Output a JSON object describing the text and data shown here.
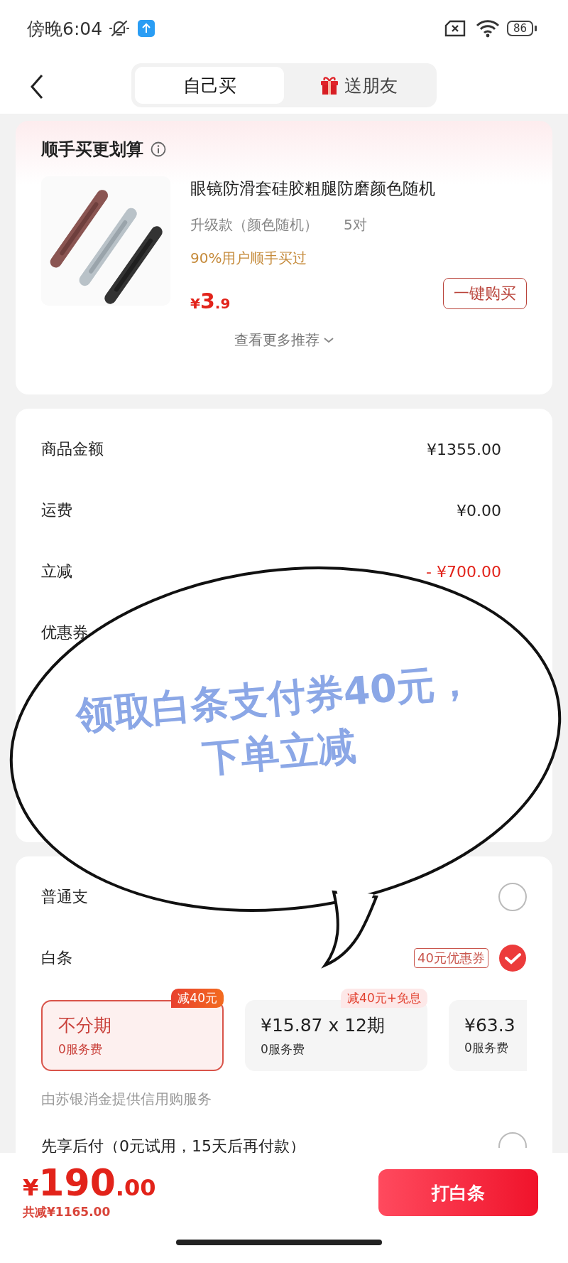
{
  "status_bar": {
    "time": "傍晚6:04",
    "battery": "86"
  },
  "tabs": [
    {
      "label": "自己买",
      "selected": true
    },
    {
      "label": "送朋友",
      "selected": false
    }
  ],
  "addon": {
    "title": "顺手买更划算",
    "product": {
      "title": "眼镜防滑套硅胶粗腿防磨颜色随机",
      "spec": "升级款（颜色随机）",
      "quantity": "5对",
      "social_proof": "90%用户顺手买过",
      "price": {
        "currency": "¥",
        "integer": "3",
        "decimal": ".9"
      },
      "button": "一键购买"
    },
    "more": "查看更多推荐"
  },
  "summary": [
    {
      "label": "商品金额",
      "value": "¥1355.00",
      "kind": "normal"
    },
    {
      "label": "运费",
      "value": "¥0.00",
      "kind": "normal"
    },
    {
      "label": "立减",
      "value": "- ¥700.00",
      "kind": "discount"
    },
    {
      "label": "优惠券"
    }
  ],
  "payment": {
    "options": [
      {
        "label": "普通支",
        "selected": false
      },
      {
        "label": "白条",
        "selected": true,
        "badge": "40元优惠券"
      }
    ],
    "plans": [
      {
        "title": "不分期",
        "fee": "0服务费",
        "tag": "减40元",
        "selected": true
      },
      {
        "title": "¥15.87 x 12期",
        "fee": "0服务费",
        "tag": "减40元+免息",
        "selected": false
      },
      {
        "title": "¥63.3",
        "fee": "0服务费",
        "selected": false
      }
    ],
    "provider": "由苏银消金提供信用购服务",
    "later": {
      "label": "先享后付（0元试用，15天后再付款）",
      "selected": false
    }
  },
  "bottom": {
    "price": {
      "currency": "¥",
      "integer": "190",
      "decimal": ".00"
    },
    "saved": "共减¥1165.00",
    "button": "打白条"
  },
  "callout": {
    "lines": [
      "领取白条支付券40元，",
      "下单立减"
    ]
  }
}
